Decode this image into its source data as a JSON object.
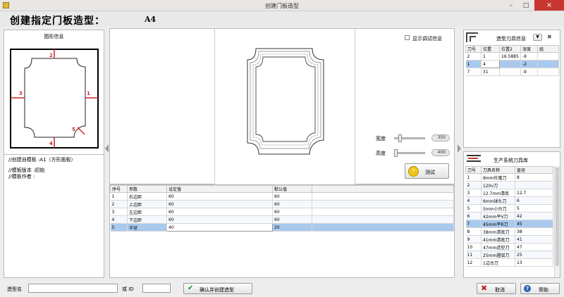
{
  "window": {
    "title": "创建门板造型",
    "min_glyph": "–",
    "max_glyph": "□",
    "close_glyph": "×"
  },
  "header": {
    "label": "创建指定门板造型：",
    "value": "A4"
  },
  "figure_panel": {
    "title": "图形信息",
    "edge_labels": [
      "1",
      "2",
      "3",
      "4",
      "5"
    ]
  },
  "template_info": {
    "lines": [
      "//创建自模板 :A1（方形面板）",
      "",
      "//模板版本 :初始",
      "//模板作者 :"
    ]
  },
  "preview": {
    "debug_checkbox_label": "显示调试信息",
    "width_label": "宽度",
    "width_value": "350",
    "height_label": "高度",
    "height_value": "400",
    "test_button": "测试"
  },
  "params_table": {
    "columns": [
      "序号",
      "参数",
      "设定值",
      "默认值"
    ],
    "rows": [
      {
        "no": "1",
        "name": "右边距",
        "value": "60",
        "default": "60"
      },
      {
        "no": "2",
        "name": "上边距",
        "value": "60",
        "default": "60"
      },
      {
        "no": "3",
        "name": "左边距",
        "value": "60",
        "default": "60"
      },
      {
        "no": "4",
        "name": "下边距",
        "value": "60",
        "default": "60"
      },
      {
        "no": "5",
        "name": "半径",
        "value": "40",
        "default": "20"
      }
    ]
  },
  "tool_info": {
    "title": "造型刀具信息",
    "dropdown_glyph": "▼",
    "close_glyph": "✖",
    "columns": [
      "刀号",
      "位置",
      "位置2",
      "深度",
      "组"
    ],
    "rows": [
      {
        "no": "2",
        "pos": "1",
        "pos2": "16.5885",
        "depth": "-9",
        "group": ""
      },
      {
        "no": "1",
        "pos": "4",
        "pos2": "",
        "depth": "-2",
        "group": ""
      },
      {
        "no": "7",
        "pos": "31",
        "pos2": "",
        "depth": "-9",
        "group": ""
      }
    ]
  },
  "tool_library": {
    "title": "生产系统刀具库",
    "columns": [
      "刀号",
      "刀具名称",
      "直径"
    ],
    "rows": [
      {
        "no": "1",
        "name": "8mm杜隆刀",
        "dia": "8"
      },
      {
        "no": "2",
        "name": "120v刀",
        "dia": ""
      },
      {
        "no": "3",
        "name": "12.7mm清底",
        "dia": "12.7"
      },
      {
        "no": "4",
        "name": "6mm球头刀",
        "dia": "6"
      },
      {
        "no": "5",
        "name": "5mm小台刀",
        "dia": "5"
      },
      {
        "no": "6",
        "name": "42mm平V刀",
        "dia": "42"
      },
      {
        "no": "7",
        "name": "45mm平R刀",
        "dia": "45"
      },
      {
        "no": "8",
        "name": "38mm清底刀",
        "dia": "38"
      },
      {
        "no": "9",
        "name": "41mm清底刀",
        "dia": "41"
      },
      {
        "no": "10",
        "name": "47mm造型刀",
        "dia": "47"
      },
      {
        "no": "11",
        "name": "25mm圆弧刀",
        "dia": "25"
      },
      {
        "no": "12",
        "name": "1边台刀",
        "dia": "13"
      }
    ]
  },
  "footer": {
    "name_label": "造型名",
    "name_value": "",
    "or_id_label": "或 ID",
    "id_value": "",
    "confirm_button": "确认并创建造型",
    "cancel_button": "取消",
    "help_button": "帮助"
  },
  "colors": {
    "selected_row": "#a9c9ed",
    "edge_marker": "#d0202a",
    "title_bar": "#e9e7e4"
  }
}
